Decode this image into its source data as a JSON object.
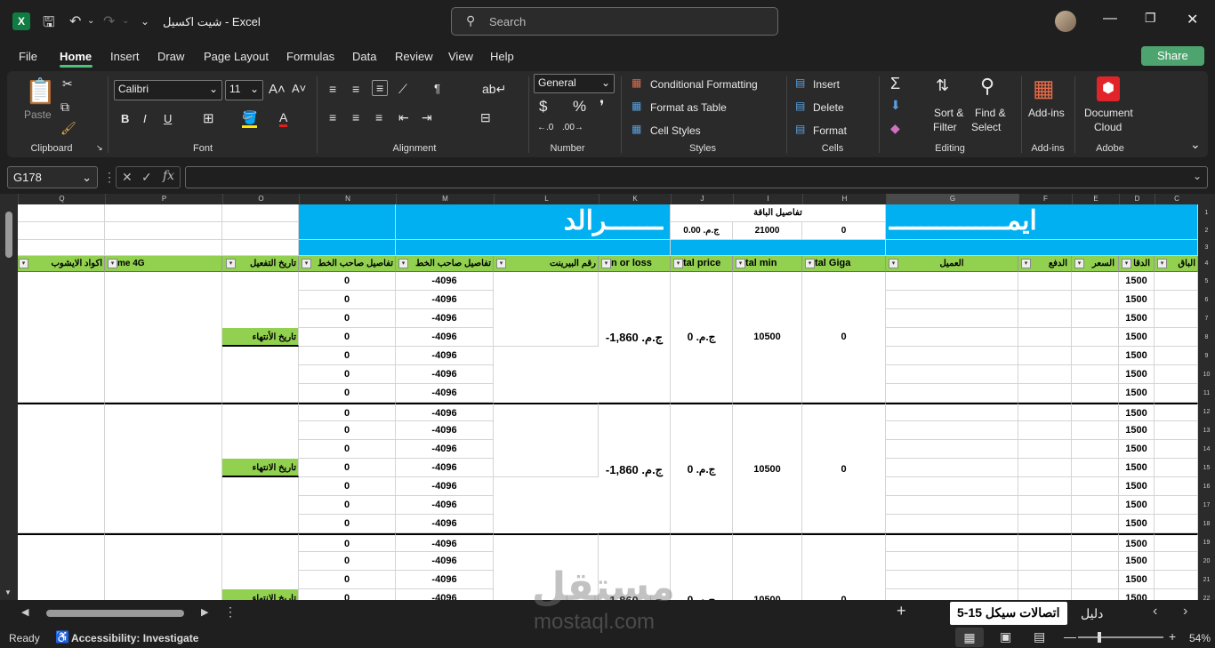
{
  "window": {
    "title": "شيت اكسيل  -  Excel",
    "search_placeholder": "Search"
  },
  "tabs": [
    "File",
    "Home",
    "Insert",
    "Draw",
    "Page Layout",
    "Formulas",
    "Data",
    "Review",
    "View",
    "Help"
  ],
  "share_label": "Share",
  "ribbon": {
    "clipboard": {
      "paste": "Paste",
      "label": "Clipboard"
    },
    "font": {
      "name": "Calibri",
      "size": "11",
      "label": "Font"
    },
    "alignment": {
      "label": "Alignment"
    },
    "number": {
      "format": "General",
      "label": "Number"
    },
    "styles": {
      "conditional": "Conditional Formatting",
      "format_table": "Format as Table",
      "cell_styles": "Cell Styles",
      "label": "Styles"
    },
    "cells": {
      "insert": "Insert",
      "delete": "Delete",
      "format": "Format",
      "label": "Cells"
    },
    "editing": {
      "sort": "Sort &",
      "filter": "Filter",
      "find": "Find &",
      "select": "Select",
      "label": "Editing"
    },
    "addins": {
      "addins": "Add-ins",
      "label": "Add-ins"
    },
    "adobe": {
      "doc": "Document",
      "cloud": "Cloud",
      "label": "Adobe"
    }
  },
  "namebox": "G178",
  "columns": [
    "Q",
    "P",
    "O",
    "N",
    "M",
    "L",
    "K",
    "J",
    "I",
    "H",
    "G",
    "F",
    "E",
    "D",
    "C"
  ],
  "sheet": {
    "title_left": "ـــــــرالد",
    "title_right": "ايمـــــــــــــــ",
    "package_details": "تفاصيل الباقة",
    "pkg_price": "ج.م. 0.00",
    "pkg_min": "21000",
    "pkg_giga": "0",
    "headers": {
      "Q": "اكواد الايشوب",
      "P": "me 4G",
      "O": "تاريخ التفعيل",
      "N": "تفاصيل صاحب الخط",
      "M": "تفاصيل صاحب الخط",
      "L": "رقم البيرينت",
      "K": "n or loss",
      "J": "tal price",
      "I": "tal min",
      "H": "tal Giga",
      "G": "العميل",
      "F": "الدفع",
      "E": "السعر",
      "D": "الدقا",
      "C": "الباق"
    },
    "end_date": [
      "تاريخ الأنتهاء",
      "تاريخ الانتهاء",
      "تاريخ الانتهاء"
    ],
    "n_val": "0",
    "m_val": "-4096",
    "d_val": "1500",
    "k_val": "-1,860 .ج.م",
    "j_val": "ج.م. 0",
    "i_val": "10500",
    "h_val": "0"
  },
  "sheet_tabs": [
    "اتصالات سيكل 15-5",
    "دليل"
  ],
  "status": {
    "ready": "Ready",
    "accessibility": "Accessibility: Investigate",
    "zoom": "54%"
  },
  "watermark": {
    "arabic": "مستقل",
    "latin": "mostaql.com"
  }
}
